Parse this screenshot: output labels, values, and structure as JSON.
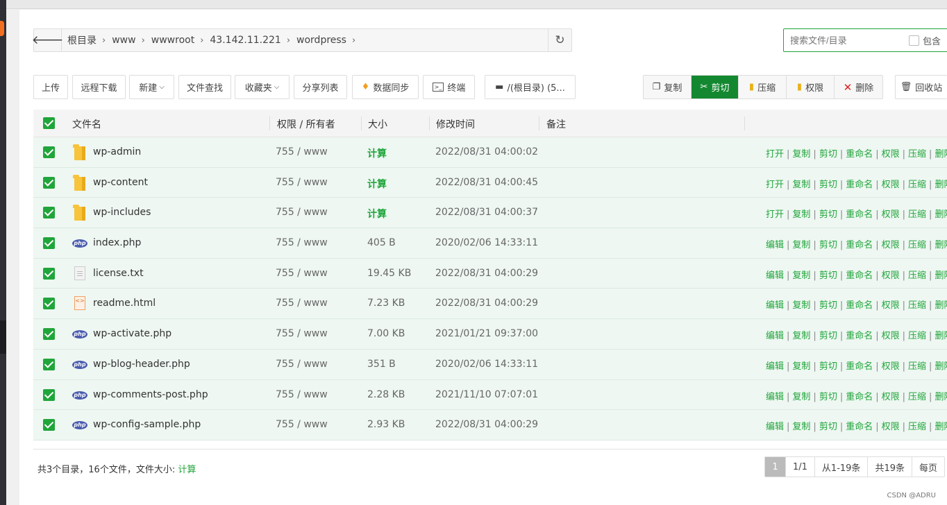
{
  "path": {
    "back_icon": "arrow-left-icon",
    "crumbs": [
      "根目录",
      "www",
      "wwwroot",
      "43.142.11.221",
      "wordpress"
    ],
    "refresh_icon": "refresh-icon"
  },
  "search": {
    "placeholder": "搜索文件/目录",
    "include_label": "包含"
  },
  "toolbar": {
    "upload": "上传",
    "remote_download": "远程下载",
    "new": "新建",
    "file_search": "文件查找",
    "favorites": "收藏夹",
    "share_list": "分享列表",
    "data_sync": "数据同步",
    "terminal": "终端",
    "disk": "/(根目录) (5...",
    "copy": "复制",
    "cut": "剪切",
    "compress": "压缩",
    "permission": "权限",
    "delete": "删除",
    "recycle": "回收站"
  },
  "table": {
    "headers": {
      "name": "文件名",
      "perm": "权限 / 所有者",
      "size": "大小",
      "mtime": "修改时间",
      "note": "备注"
    },
    "rows": [
      {
        "name": "wp-admin",
        "type": "folder",
        "perm": "755 / www",
        "size": "计算",
        "mtime": "2022/08/31 04:00:02",
        "open": "打开"
      },
      {
        "name": "wp-content",
        "type": "folder",
        "perm": "755 / www",
        "size": "计算",
        "mtime": "2022/08/31 04:00:45",
        "open": "打开"
      },
      {
        "name": "wp-includes",
        "type": "folder",
        "perm": "755 / www",
        "size": "计算",
        "mtime": "2022/08/31 04:00:37",
        "open": "打开"
      },
      {
        "name": "index.php",
        "type": "php",
        "perm": "755 / www",
        "size": "405 B",
        "mtime": "2020/02/06 14:33:11",
        "open": "编辑"
      },
      {
        "name": "license.txt",
        "type": "txt",
        "perm": "755 / www",
        "size": "19.45 KB",
        "mtime": "2022/08/31 04:00:29",
        "open": "编辑"
      },
      {
        "name": "readme.html",
        "type": "html",
        "perm": "755 / www",
        "size": "7.23 KB",
        "mtime": "2022/08/31 04:00:29",
        "open": "编辑"
      },
      {
        "name": "wp-activate.php",
        "type": "php",
        "perm": "755 / www",
        "size": "7.00 KB",
        "mtime": "2021/01/21 09:37:00",
        "open": "编辑"
      },
      {
        "name": "wp-blog-header.php",
        "type": "php",
        "perm": "755 / www",
        "size": "351 B",
        "mtime": "2020/02/06 14:33:11",
        "open": "编辑"
      },
      {
        "name": "wp-comments-post.php",
        "type": "php",
        "perm": "755 / www",
        "size": "2.28 KB",
        "mtime": "2021/11/10 07:07:01",
        "open": "编辑"
      },
      {
        "name": "wp-config-sample.php",
        "type": "php",
        "perm": "755 / www",
        "size": "2.93 KB",
        "mtime": "2022/08/31 04:00:29",
        "open": "编辑"
      }
    ],
    "ops": [
      "复制",
      "剪切",
      "重命名",
      "权限",
      "压缩",
      "删除"
    ]
  },
  "footer": {
    "summary": "共3个目录，16个文件，文件大小:",
    "calc_link": "计算",
    "pager": {
      "current": "1",
      "pages": "1/1",
      "range": "从1-19条",
      "total": "共19条",
      "per_page": "每页"
    }
  },
  "watermark": "CSDN @ADRU",
  "colors": {
    "accent": "#20a53a",
    "active_button": "#138830",
    "row_bg": "#eef7f2"
  }
}
